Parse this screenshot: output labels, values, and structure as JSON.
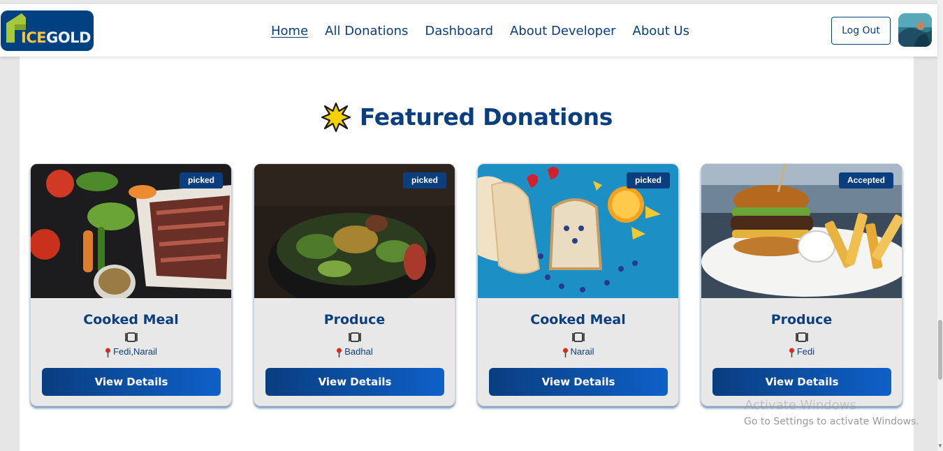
{
  "brand": {
    "logo_ice": "ICE",
    "logo_gold": "GOLD"
  },
  "nav": {
    "items": [
      {
        "label": "Home",
        "active": true
      },
      {
        "label": "All Donations"
      },
      {
        "label": "Dashboard"
      },
      {
        "label": "About Developer"
      },
      {
        "label": "About Us"
      }
    ],
    "logout_label": "Log Out"
  },
  "main": {
    "heading": "Featured Donations",
    "cards": [
      {
        "status": "picked",
        "title": "Cooked Meal",
        "location": "Fedi,Narail",
        "button": "View Details"
      },
      {
        "status": "picked",
        "title": "Produce",
        "location": "Badhal",
        "button": "View Details"
      },
      {
        "status": "picked",
        "title": "Cooked Meal",
        "location": "Narail",
        "button": "View Details"
      },
      {
        "status": "Accepted",
        "title": "Produce",
        "location": "Fedi",
        "button": "View Details"
      }
    ]
  },
  "watermark": {
    "title": "Activate Windows",
    "subtitle": "Go to Settings to activate Windows."
  },
  "colors": {
    "brand_blue": "#0a3e7f",
    "button_gradient_end": "#0e60c8",
    "card_bg": "#e8e8e8",
    "star_yellow": "#f5d100"
  },
  "icons": [
    "featured-star-icon",
    "meal-plate-icon",
    "location-pin-icon"
  ]
}
